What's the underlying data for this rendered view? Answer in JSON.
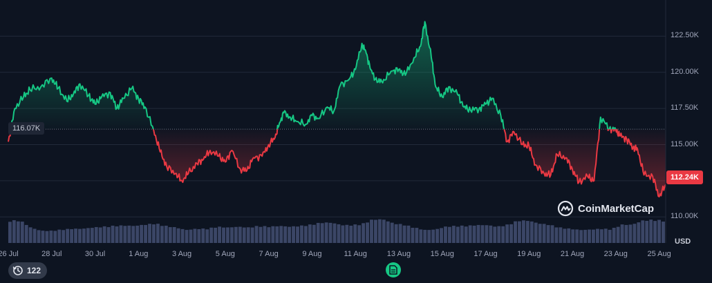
{
  "chart_data": {
    "type": "line",
    "title": "",
    "xlabel": "",
    "ylabel": "",
    "currency": "USD",
    "reference_price": "116.07K",
    "reference_value": 116.07,
    "current_price": "112.24K",
    "current_value": 112.24,
    "ylim": [
      108.2,
      125.0
    ],
    "y_ticks": [
      "110.00K",
      "112.50K",
      "115.00K",
      "117.50K",
      "120.00K",
      "122.50K"
    ],
    "y_tick_values": [
      110.0,
      112.5,
      115.0,
      117.5,
      120.0,
      122.5
    ],
    "x_ticks": [
      "26 Jul",
      "28 Jul",
      "30 Jul",
      "1 Aug",
      "3 Aug",
      "5 Aug",
      "7 Aug",
      "9 Aug",
      "11 Aug",
      "13 Aug",
      "15 Aug",
      "17 Aug",
      "19 Aug",
      "21 Aug",
      "23 Aug",
      "25 Aug"
    ],
    "x_tick_positions": [
      0,
      2,
      4,
      6,
      8,
      10,
      12,
      14,
      16,
      18,
      20,
      22,
      24,
      26,
      28,
      30
    ],
    "xlim": [
      0,
      30.3
    ],
    "price": {
      "x": [
        0,
        0.3,
        0.7,
        1.0,
        1.5,
        2.0,
        2.3,
        2.7,
        3.0,
        3.3,
        3.7,
        4.0,
        4.3,
        4.7,
        5.0,
        5.3,
        5.7,
        6.0,
        6.3,
        6.7,
        7.0,
        7.3,
        7.7,
        8.0,
        8.3,
        8.7,
        9.0,
        9.3,
        9.7,
        10.0,
        10.3,
        10.7,
        11.0,
        11.3,
        11.7,
        12.0,
        12.3,
        12.5,
        12.7,
        13.0,
        13.3,
        13.7,
        14.0,
        14.3,
        14.7,
        15.0,
        15.3,
        15.7,
        16.0,
        16.3,
        16.5,
        16.7,
        17.0,
        17.3,
        17.7,
        18.0,
        18.3,
        18.7,
        19.0,
        19.2,
        19.5,
        19.7,
        20.0,
        20.3,
        20.7,
        21.0,
        21.3,
        21.7,
        22.0,
        22.3,
        22.7,
        23.0,
        23.3,
        23.7,
        24.0,
        24.3,
        24.7,
        25.0,
        25.3,
        25.7,
        26.0,
        26.3,
        26.7,
        27.0,
        27.3,
        27.7,
        28.0,
        28.2,
        28.5,
        28.8,
        29.0,
        29.3,
        29.7,
        30.0,
        30.3
      ],
      "y": [
        115.2,
        117.5,
        118.3,
        118.8,
        119.0,
        119.6,
        118.9,
        118.0,
        118.5,
        119.2,
        118.4,
        117.8,
        118.3,
        118.6,
        117.5,
        118.2,
        118.9,
        118.2,
        117.6,
        116.0,
        114.5,
        113.5,
        113.0,
        112.5,
        113.0,
        113.7,
        114.0,
        114.6,
        114.2,
        113.8,
        114.6,
        113.3,
        113.2,
        114.1,
        114.2,
        115.0,
        115.5,
        116.5,
        117.2,
        116.9,
        116.6,
        116.4,
        117.0,
        116.8,
        117.6,
        117.3,
        119.1,
        119.5,
        120.2,
        122.0,
        121.3,
        120.2,
        119.3,
        119.5,
        120.1,
        120.2,
        119.8,
        121.0,
        121.8,
        123.5,
        121.0,
        119.0,
        118.3,
        119.0,
        118.5,
        117.6,
        117.4,
        117.5,
        117.8,
        118.2,
        117.0,
        115.2,
        115.9,
        115.0,
        114.9,
        113.6,
        113.0,
        112.9,
        114.3,
        114.1,
        113.3,
        112.4,
        112.8,
        112.5,
        116.9,
        116.1,
        116.0,
        115.6,
        115.4,
        114.8,
        114.7,
        112.9,
        112.8,
        111.4,
        112.24
      ]
    },
    "volume_level": [
      0.55,
      0.55,
      0.38,
      0.3,
      0.3,
      0.33,
      0.35,
      0.35,
      0.38,
      0.4,
      0.42,
      0.43,
      0.42,
      0.45,
      0.48,
      0.42,
      0.38,
      0.32,
      0.35,
      0.35,
      0.4,
      0.38,
      0.4,
      0.38,
      0.42,
      0.4,
      0.42,
      0.4,
      0.42,
      0.45,
      0.5,
      0.5,
      0.44,
      0.44,
      0.47,
      0.58,
      0.58,
      0.48,
      0.45,
      0.38,
      0.32,
      0.33,
      0.4,
      0.42,
      0.42,
      0.44,
      0.44,
      0.4,
      0.45,
      0.55,
      0.55,
      0.48,
      0.45,
      0.38,
      0.35,
      0.32,
      0.33,
      0.35,
      0.34,
      0.45,
      0.45,
      0.55,
      0.57,
      0.55
    ],
    "colors": {
      "up": "#16c784",
      "down": "#ea3943",
      "grid": "#222a3a",
      "volume": "#3b4666",
      "background": "#0d1421"
    }
  },
  "watermark": "CoinMarketCap",
  "event_count": "122",
  "icons": {
    "history": "history-clock-icon",
    "news": "document-news-icon",
    "logo": "coinmarketcap-logo-icon"
  }
}
